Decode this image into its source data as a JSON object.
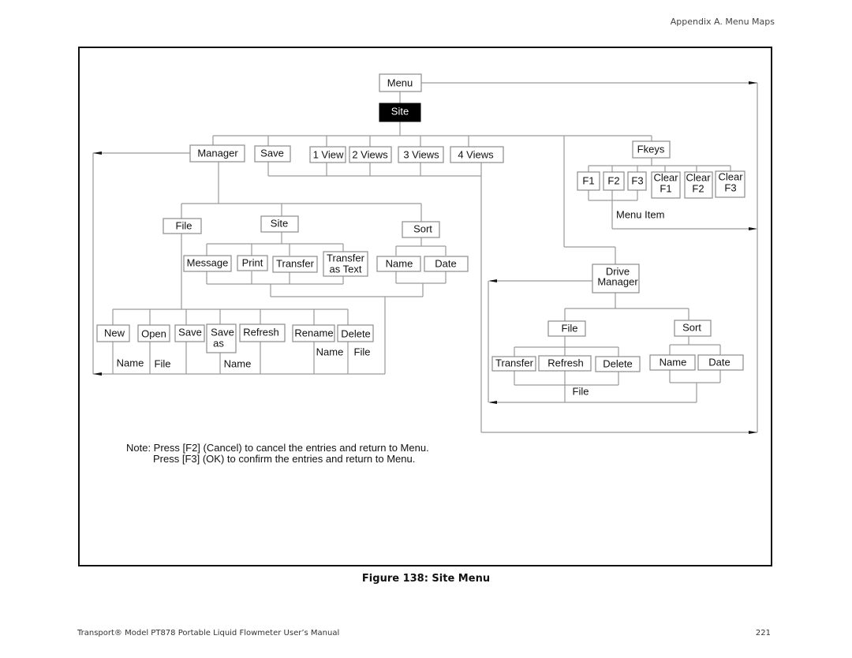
{
  "page": {
    "header": "Appendix A. Menu Maps",
    "caption": "Figure 138:  Site Menu",
    "footer_left": "Transport® Model PT878 Portable Liquid Flowmeter User’s Manual",
    "footer_right": "221"
  },
  "diagram": {
    "root": "Menu",
    "site": "Site",
    "level1": {
      "manager": "Manager",
      "save": "Save",
      "view1": "1 View",
      "views2": "2 Views",
      "views3": "3 Views",
      "views4": "4 Views",
      "fkeys": "Fkeys"
    },
    "manager": {
      "file": "File",
      "site": "Site",
      "sort": "Sort",
      "site_items": [
        "Message",
        "Print",
        "Transfer",
        "Transfer",
        "as Text"
      ],
      "sort_items": [
        "Name",
        "Date"
      ],
      "file_items": [
        "New",
        "Open",
        "Save",
        "Save",
        "as",
        "Refresh",
        "Rename",
        "Delete"
      ],
      "file_params": {
        "new_name": "Name",
        "open_file": "File",
        "saveas_name": "Name",
        "rename_name": "Name",
        "delete_file": "File"
      }
    },
    "fkeys": {
      "keys": [
        "F1",
        "F2",
        "F3"
      ],
      "clear": [
        [
          "Clear",
          "F1"
        ],
        [
          "Clear",
          "F2"
        ],
        [
          "Clear",
          "F3"
        ]
      ],
      "menu_item": "Menu Item"
    },
    "drive_manager": {
      "title_line1": "Drive",
      "title_line2": "Manager",
      "file": "File",
      "sort": "Sort",
      "file_items": [
        "Transfer",
        "Refresh",
        "Delete"
      ],
      "sort_items": [
        "Name",
        "Date"
      ],
      "file_param": "File"
    },
    "note_line1": "Note: Press [F2] (Cancel) to cancel the entries and return to Menu.",
    "note_line2": "Press [F3] (OK) to confirm the entries and return to Menu."
  }
}
